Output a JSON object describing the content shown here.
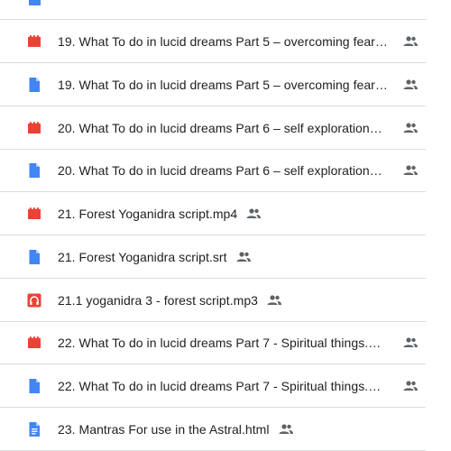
{
  "files": [
    {
      "name": "19. What To do in lucid dreams Part 5 – overcoming fear…",
      "type": "video-icon",
      "shared": true
    },
    {
      "name": "19. What To do in lucid dreams Part 5 – overcoming fear…",
      "type": "file-icon",
      "shared": true
    },
    {
      "name": "20. What To do in lucid dreams Part 6 – self exploration…",
      "type": "video-icon",
      "shared": true
    },
    {
      "name": "20. What To do in lucid dreams Part 6 – self exploration…",
      "type": "file-icon",
      "shared": true
    },
    {
      "name": "21. Forest Yoganidra script.mp4",
      "type": "video-icon",
      "shared": true
    },
    {
      "name": "21. Forest Yoganidra script.srt",
      "type": "file-icon",
      "shared": true
    },
    {
      "name": "21.1 yoganidra 3 - forest script.mp3",
      "type": "audio-icon",
      "shared": true
    },
    {
      "name": "22. What To do in lucid dreams Part 7 - Spiritual things.…",
      "type": "video-icon",
      "shared": true
    },
    {
      "name": "22. What To do in lucid dreams Part 7 - Spiritual things.…",
      "type": "file-icon",
      "shared": true
    },
    {
      "name": "23. Mantras For use in the Astral.html",
      "type": "document-icon",
      "shared": true
    }
  ],
  "colors": {
    "video": "#ea4335",
    "audio": "#ea4335",
    "file": "#4285f4",
    "text": "#202124",
    "shared": "#5f6368",
    "divider": "#dadce0"
  },
  "icons": {
    "shared": "people-icon"
  }
}
